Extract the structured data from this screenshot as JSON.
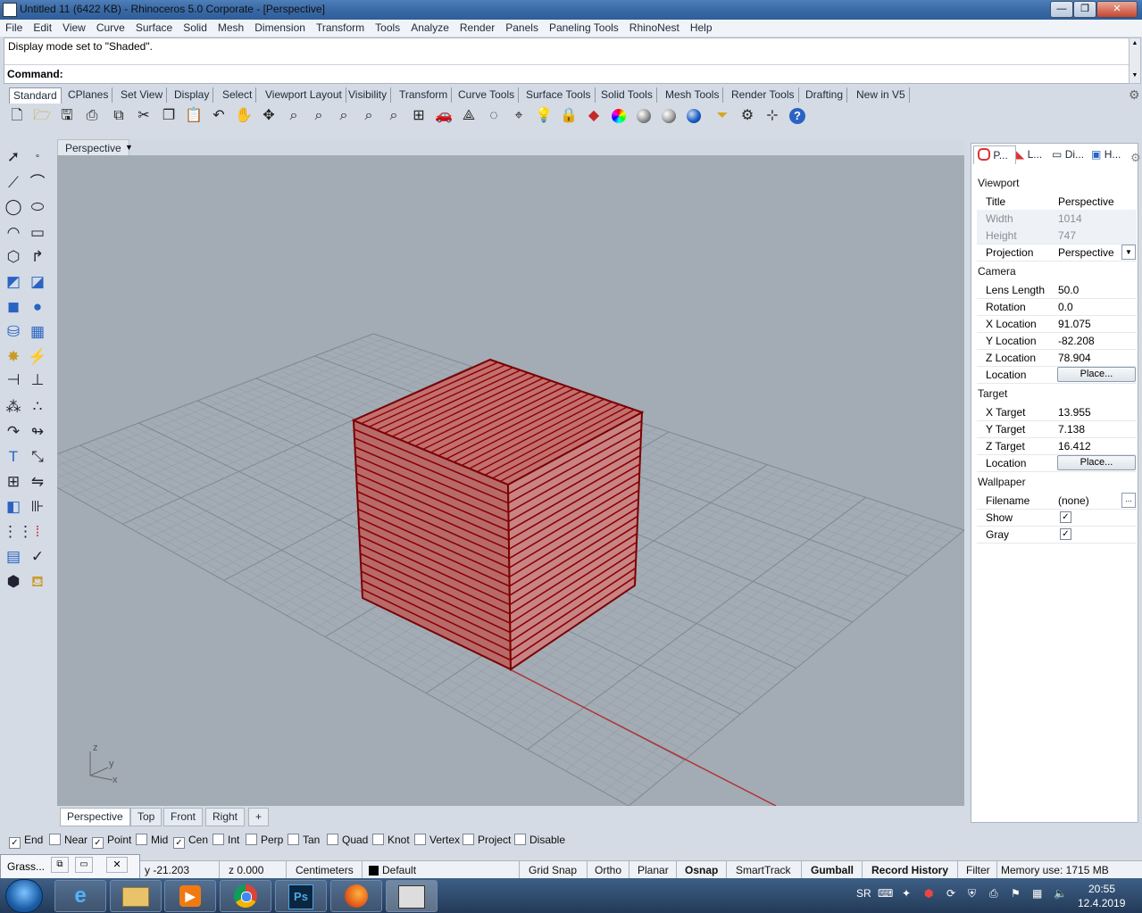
{
  "window": {
    "title": "Untitled 11 (6422 KB) - Rhinoceros  5.0 Corporate - [Perspective]",
    "minimize_label": "—",
    "maximize_label": "❐",
    "close_label": "✕"
  },
  "menu": [
    "File",
    "Edit",
    "View",
    "Curve",
    "Surface",
    "Solid",
    "Mesh",
    "Dimension",
    "Transform",
    "Tools",
    "Analyze",
    "Render",
    "Panels",
    "Paneling Tools",
    "RhinoNest",
    "Help"
  ],
  "command": {
    "history": "Display mode set to \"Shaded\".",
    "prompt_label": "Command:",
    "value": ""
  },
  "toolbar_tabs": [
    "Standard",
    "CPlanes",
    "Set View",
    "Display",
    "Select",
    "Viewport Layout",
    "Visibility",
    "Transform",
    "Curve Tools",
    "Surface Tools",
    "Solid Tools",
    "Mesh Tools",
    "Render Tools",
    "Drafting",
    "New in V5"
  ],
  "toolbar_icons": [
    "new-icon",
    "open-icon",
    "save-icon",
    "print-icon",
    "import-icon",
    "cut-icon",
    "copy-icon",
    "paste-icon",
    "undo-icon",
    "pan-icon",
    "rotate-view-icon",
    "zoom-icon",
    "zoom-window-icon",
    "zoom-extents-icon",
    "zoom-selected-icon",
    "zoom-previous-icon",
    "viewport-layout-icon",
    "car-icon",
    "wireframe-icon",
    "cplane-icon",
    "osnap-icon",
    "light-icon",
    "lock-icon",
    "material-icon",
    "color-wheel-icon",
    "render-sphere-icon",
    "shaded-sphere-icon",
    "blue-sphere-icon",
    "filter-icon",
    "gear-icon",
    "gumball-icon",
    "help-icon"
  ],
  "viewport": {
    "title": "Perspective",
    "axis_z": "z",
    "axis_y": "y",
    "axis_x": "x"
  },
  "view_tabs": [
    "Perspective",
    "Top",
    "Front",
    "Right"
  ],
  "view_tab_add": "+",
  "osnaps": [
    {
      "label": "End",
      "checked": true
    },
    {
      "label": "Near",
      "checked": false
    },
    {
      "label": "Point",
      "checked": true
    },
    {
      "label": "Mid",
      "checked": false
    },
    {
      "label": "Cen",
      "checked": true
    },
    {
      "label": "Int",
      "checked": false
    },
    {
      "label": "Perp",
      "checked": false
    },
    {
      "label": "Tan",
      "checked": false
    },
    {
      "label": "Quad",
      "checked": false
    },
    {
      "label": "Knot",
      "checked": false
    },
    {
      "label": "Vertex",
      "checked": false
    },
    {
      "label": "Project",
      "checked": false
    },
    {
      "label": "Disable",
      "checked": false
    }
  ],
  "status": {
    "grasshopper_title": "Grass...",
    "y": "y -21.203",
    "z": "z 0.000",
    "units": "Centimeters",
    "layer": "Default",
    "grid_snap": "Grid Snap",
    "ortho": "Ortho",
    "planar": "Planar",
    "osnap": "Osnap",
    "smarttrack": "SmartTrack",
    "gumball": "Gumball",
    "record_history": "Record History",
    "filter": "Filter",
    "memory": "Memory use: 1715 MB"
  },
  "panel": {
    "tabs": [
      "P...",
      "L...",
      "Di...",
      "H..."
    ],
    "sections": {
      "viewport": "Viewport",
      "camera": "Camera",
      "target": "Target",
      "wallpaper": "Wallpaper"
    },
    "viewport_props": [
      {
        "label": "Title",
        "value": "Perspective"
      },
      {
        "label": "Width",
        "value": "1014"
      },
      {
        "label": "Height",
        "value": "747"
      },
      {
        "label": "Projection",
        "value": "Perspective"
      }
    ],
    "camera_props": [
      {
        "label": "Lens Length",
        "value": "50.0"
      },
      {
        "label": "Rotation",
        "value": "0.0"
      },
      {
        "label": "X Location",
        "value": "91.075"
      },
      {
        "label": "Y Location",
        "value": "-82.208"
      },
      {
        "label": "Z Location",
        "value": "78.904"
      },
      {
        "label": "Location",
        "value": "Place..."
      }
    ],
    "target_props": [
      {
        "label": "X Target",
        "value": "13.955"
      },
      {
        "label": "Y Target",
        "value": "7.138"
      },
      {
        "label": "Z Target",
        "value": "16.412"
      },
      {
        "label": "Location",
        "value": "Place..."
      }
    ],
    "wallpaper_props": [
      {
        "label": "Filename",
        "value": "(none)"
      },
      {
        "label": "Show",
        "checked": true
      },
      {
        "label": "Gray",
        "checked": true
      }
    ]
  },
  "taskbar": {
    "apps": [
      "ie-icon",
      "explorer-icon",
      "media-player-icon",
      "chrome-icon",
      "photoshop-icon",
      "firefox-icon",
      "rhino-icon"
    ],
    "photoshop_label": "Ps",
    "lang": "SR",
    "time": "20:55",
    "date": "12.4.2019"
  },
  "colors": {
    "cube_red": "#8b0000",
    "viewport_bg": "#a3abb5",
    "grid_line": "#8e969f",
    "axis_red": "#b03030"
  }
}
